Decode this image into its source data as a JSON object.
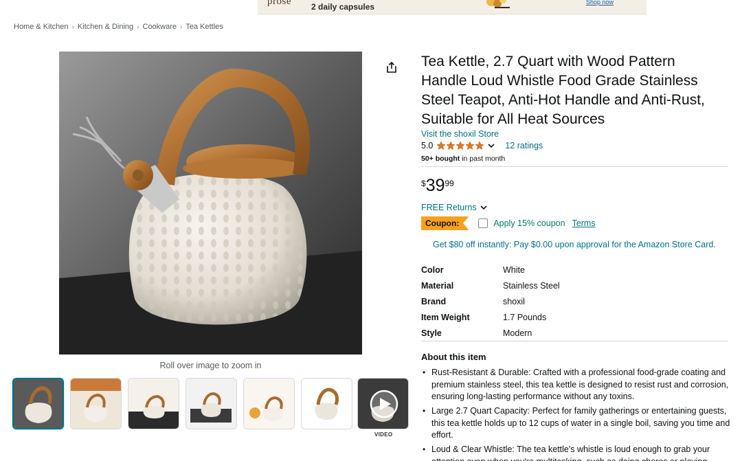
{
  "ad": {
    "brand": "prose",
    "text": "2 daily capsules",
    "cta": "Shop now"
  },
  "breadcrumb": [
    "Home & Kitchen",
    "Kitchen & Dining",
    "Cookware",
    "Tea Kettles"
  ],
  "gallery": {
    "zoom_hint": "Roll over image to zoom in",
    "video_label": "VIDEO",
    "thumbnails": [
      "kettle-front",
      "kettle-lifestyle",
      "kettle-stove",
      "kettle-induction",
      "kettle-kitchen",
      "kettle-dimensions",
      "video"
    ]
  },
  "product": {
    "title": "Tea Kettle, 2.7 Quart with Wood Pattern Handle Loud Whistle Food Grade Stainless Steel Teapot, Anti-Hot Handle and Anti-Rust, Suitable for All Heat Sources",
    "store_link": "Visit the shoxil Store",
    "rating": "5.0",
    "rating_stars": 5,
    "ratings_count": "12 ratings",
    "bought_bold": "50+ bought",
    "bought_rest": " in past month",
    "price_symbol": "$",
    "price_whole": "39",
    "price_fraction": "99",
    "returns": "FREE Returns",
    "coupon_badge": "Coupon:",
    "coupon_text": "Apply 15% coupon",
    "coupon_terms": "Terms",
    "card_offer": "Get $80 off instantly: Pay $0.00 upon approval for the Amazon Store Card."
  },
  "specs": [
    {
      "key": "Color",
      "value": "White"
    },
    {
      "key": "Material",
      "value": "Stainless Steel"
    },
    {
      "key": "Brand",
      "value": "shoxil"
    },
    {
      "key": "Item Weight",
      "value": "1.7 Pounds"
    },
    {
      "key": "Style",
      "value": "Modern"
    }
  ],
  "about": {
    "title": "About this item",
    "bullets": [
      "Rust-Resistant & Durable: Crafted with a professional food-grade coating and premium stainless steel, this tea kettle is designed to resist rust and corrosion, ensuring long-lasting performance without any toxins.",
      "Large 2.7 Quart Capacity: Perfect for family gatherings or entertaining guests, this tea kettle holds up to 12 cups of water in a single boil, saving you time and effort.",
      "Loud & Clear Whistle: The tea kettle's whistle is loud enough to grab your attention even when you're multitasking, such as doing chores or playing"
    ]
  },
  "colors": {
    "link": "#007185",
    "coupon_badge": "#f7a11a",
    "coupon_text": "#067d62",
    "star": "#de7921",
    "thumb_active": "#007185"
  }
}
